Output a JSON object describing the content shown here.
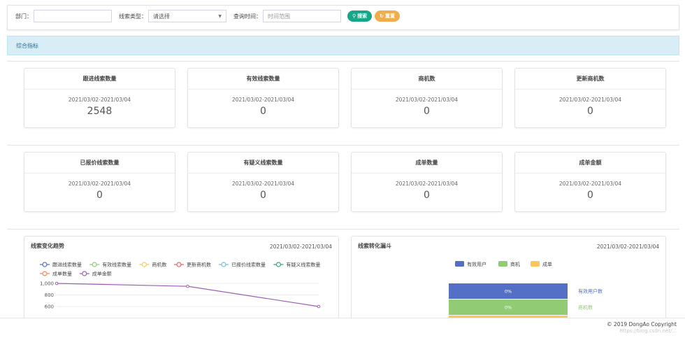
{
  "filters": {
    "dept_label": "部门：",
    "dept_value": "",
    "type_label": "线索类型：",
    "type_value": "请选择",
    "time_label": "查询时间：",
    "time_placeholder": "时间范围",
    "search_label": "搜索",
    "reset_label": "重置"
  },
  "banner_title": "综合指标",
  "cards_row1": [
    {
      "title": "跟进线索数量",
      "date": "2021/03/02-2021/03/04",
      "value": "2548"
    },
    {
      "title": "有效线索数量",
      "date": "2021/03/02-2021/03/04",
      "value": "0"
    },
    {
      "title": "商机数",
      "date": "2021/03/02-2021/03/04",
      "value": "0"
    },
    {
      "title": "更新商机数",
      "date": "2021/03/02-2021/03/04",
      "value": "0"
    }
  ],
  "cards_row2": [
    {
      "title": "已报价线索数量",
      "date": "2021/03/02-2021/03/04",
      "value": "0"
    },
    {
      "title": "有疑义线索数量",
      "date": "2021/03/02-2021/03/04",
      "value": "0"
    },
    {
      "title": "成单数量",
      "date": "2021/03/02-2021/03/04",
      "value": "0"
    },
    {
      "title": "成单金额",
      "date": "2021/03/02-2021/03/04",
      "value": "0"
    }
  ],
  "trend_panel": {
    "title": "线索变化趋势",
    "date": "2021/03/02-2021/03/04"
  },
  "funnel_panel": {
    "title": "线索转化漏斗",
    "date": "2021/03/02-2021/03/04"
  },
  "chart_data": [
    {
      "type": "line",
      "legend_position": "top-left",
      "grid": true,
      "series": [
        {
          "name": "跟进线索数量",
          "color": "#5470c6",
          "values": []
        },
        {
          "name": "有效线索数量",
          "color": "#91cc75",
          "values": []
        },
        {
          "name": "商机数",
          "color": "#fac858",
          "values": []
        },
        {
          "name": "更新商机数",
          "color": "#ee6666",
          "values": []
        },
        {
          "name": "已报价线索数量",
          "color": "#73c0de",
          "values": []
        },
        {
          "name": "有疑义线索数量",
          "color": "#3ba272",
          "values": []
        },
        {
          "name": "成单数量",
          "color": "#fc8452",
          "values": []
        },
        {
          "name": "成单金额",
          "color": "#9a60b4",
          "values": [
            1000,
            950,
            600
          ]
        }
      ],
      "y_ticks": [
        "1,000",
        "800",
        "600"
      ],
      "ylim": [
        600,
        1000
      ]
    },
    {
      "type": "bar",
      "subtype": "funnel",
      "legend_position": "top-center",
      "legend": [
        {
          "name": "有效用户",
          "color": "#5470c6"
        },
        {
          "name": "商机",
          "color": "#91cc75"
        },
        {
          "name": "成单",
          "color": "#fac858"
        }
      ],
      "stages": [
        {
          "name": "有效用户数",
          "value_label": "0%",
          "color": "#5470c6"
        },
        {
          "name": "商机数",
          "value_label": "0%",
          "color": "#91cc75"
        }
      ]
    }
  ],
  "footer": {
    "copyright": "© 2019 DongAo Copyright",
    "watermark": "https://blog.csdn.net/..."
  }
}
